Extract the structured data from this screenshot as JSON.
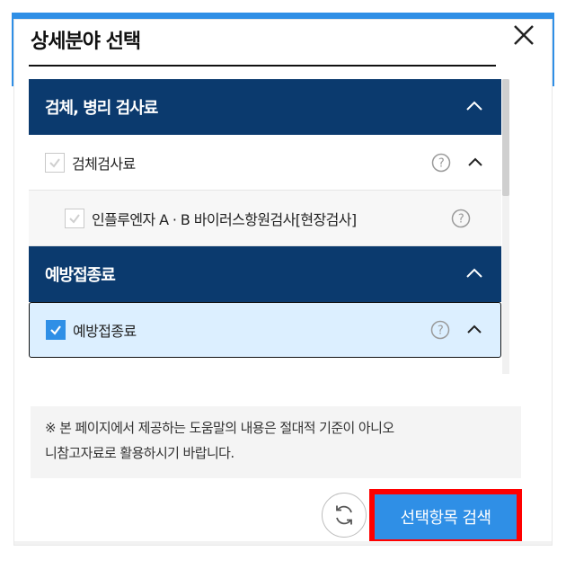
{
  "dialog": {
    "title": "상세분야 선택",
    "close_icon": "close-icon"
  },
  "categories": [
    {
      "label": "검체, 병리 검사료",
      "expanded": true,
      "items": [
        {
          "label": "검체검사료",
          "checked": false,
          "help": true,
          "expanded": true,
          "subitems": [
            {
              "label": "인플루엔자 A · B 바이러스항원검사[현장검사]",
              "checked": false,
              "help": true
            }
          ]
        }
      ]
    },
    {
      "label": "예방접종료",
      "expanded": true,
      "items": [
        {
          "label": "예방접종료",
          "checked": true,
          "help": true,
          "expanded": true
        }
      ]
    }
  ],
  "notice": {
    "line1": "※ 본 페이지에서 제공하는 도움말의 내용은 절대적 기준이 아니오",
    "line2": "니참고자료로 활용하시기 바랍니다."
  },
  "actions": {
    "refresh_icon": "refresh-icon",
    "search_label": "선택항목 검색"
  },
  "colors": {
    "accent": "#2f8fe6",
    "header_navy": "#0b3a6e",
    "highlight_border": "#ff0000",
    "selected_bg": "#dcefff"
  }
}
